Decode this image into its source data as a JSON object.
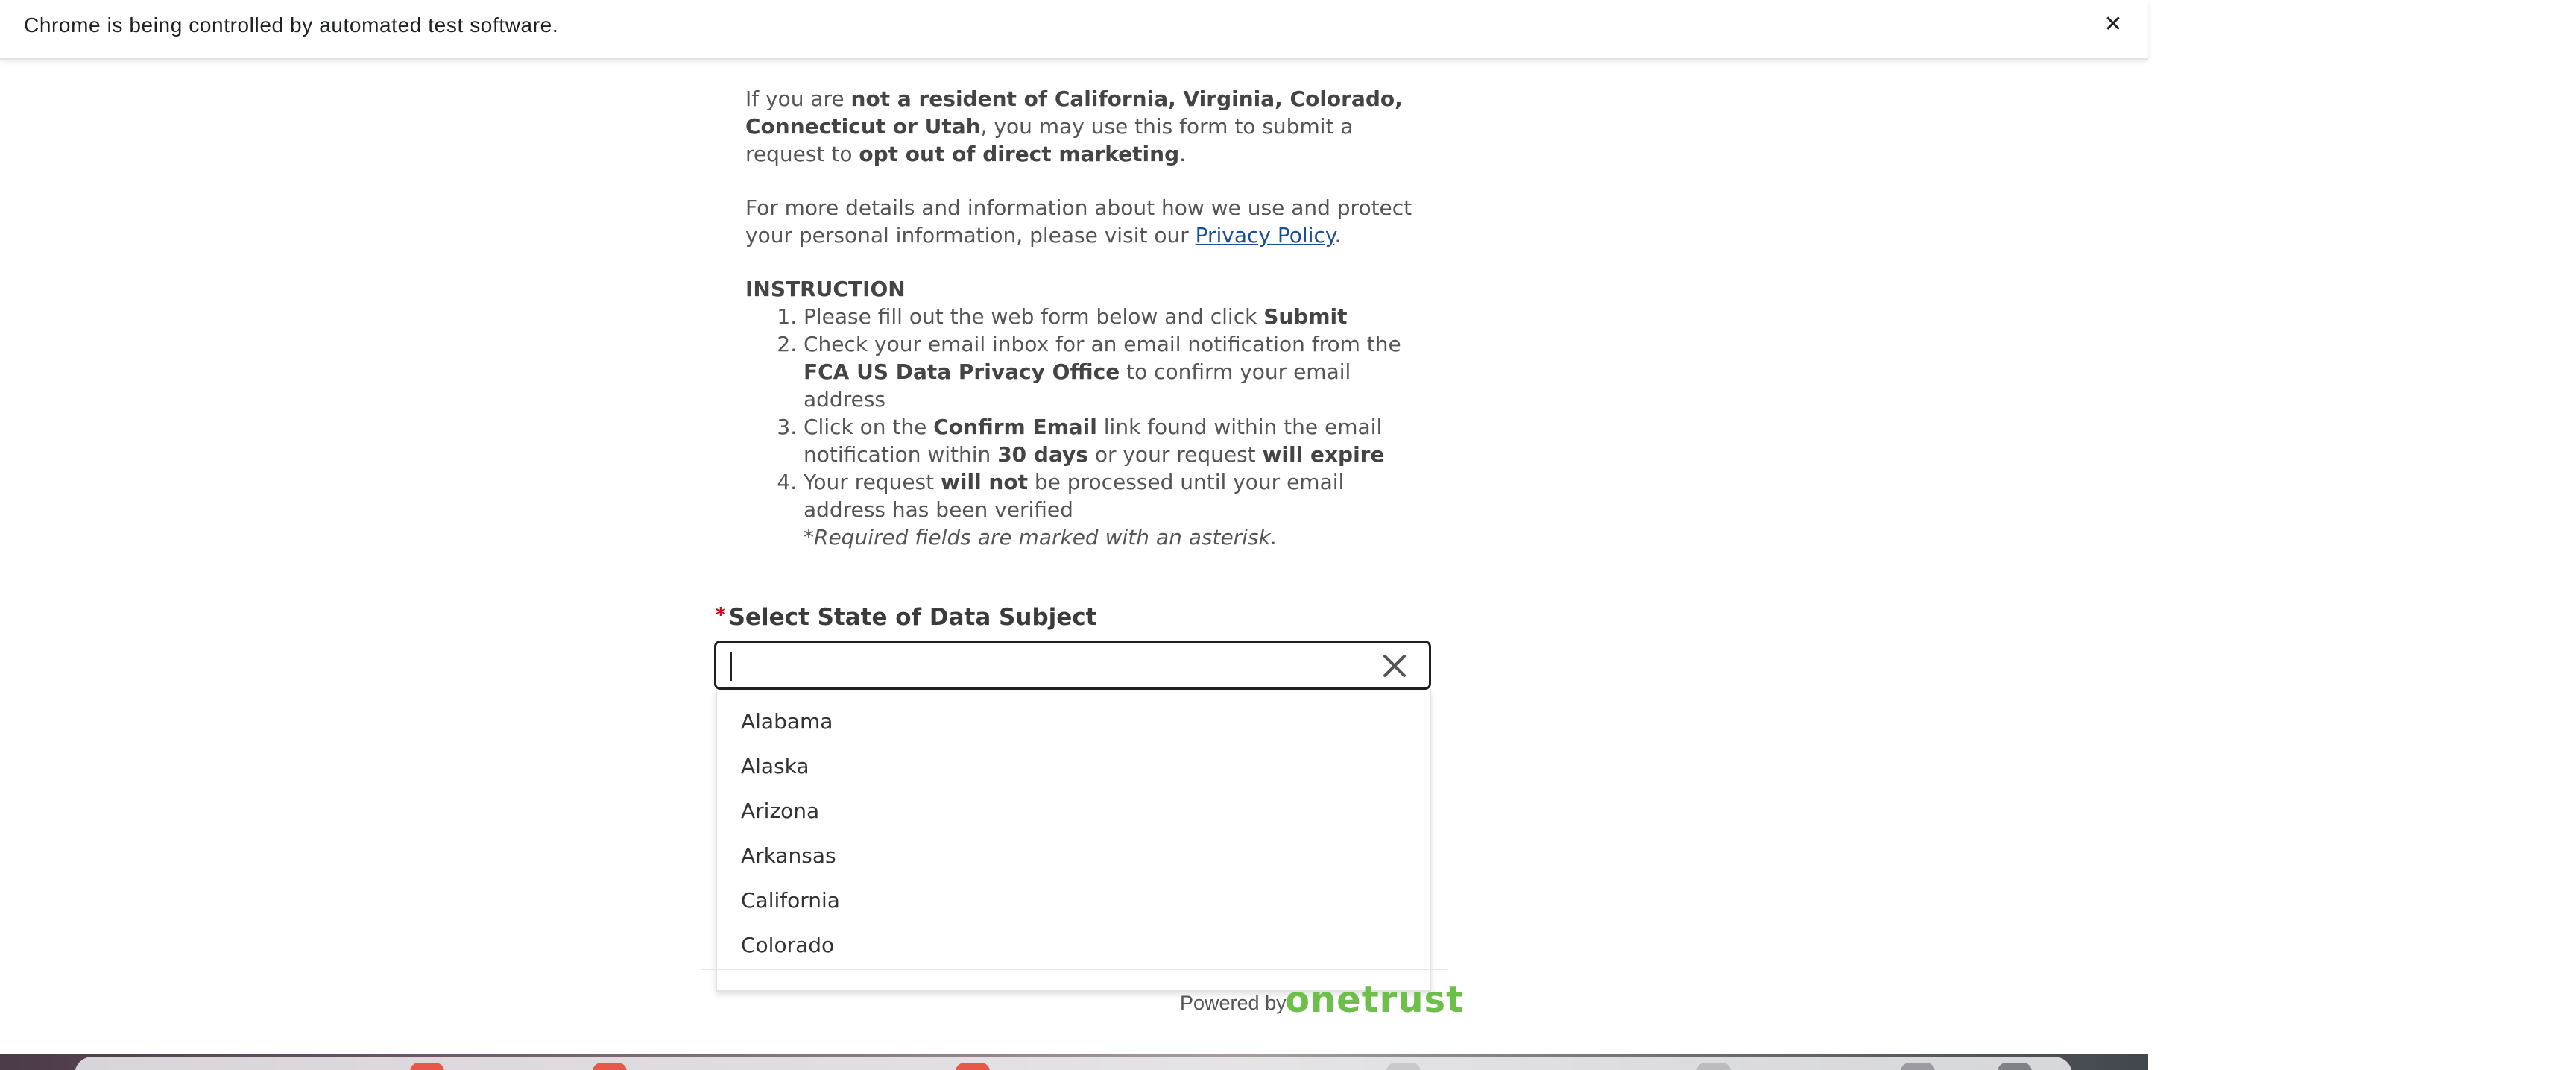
{
  "infobar": {
    "message": "Chrome is being controlled by automated test software.",
    "close_icon": "close-icon"
  },
  "intro": {
    "p1_a": "If you are ",
    "p1_b": "not a resident of California, Virginia, Colorado, Connecticut or Utah",
    "p1_c": ", you may use this form to submit a request to ",
    "p1_d": "opt out of direct marketing",
    "p1_e": ".",
    "p2_a": "For more details and information about how we use and protect your personal information, please visit our ",
    "p2_link": "Privacy Policy",
    "p2_e": "."
  },
  "instructions": {
    "title": "INSTRUCTION",
    "s1_a": "Please fill out the web form below and click ",
    "s1_b": "Submit",
    "s2_a": "Check your email inbox for an email notification from the ",
    "s2_b": "FCA US Data Privacy Office",
    "s2_c": " to confirm your email address",
    "s3_a": "Click on the ",
    "s3_b": "Confirm Email",
    "s3_c": " link found within the email notification within ",
    "s3_d": "30 days",
    "s3_e": " or your request ",
    "s3_f": "will expire",
    "s4_a": "Your request ",
    "s4_b": "will not",
    "s4_c": " be processed until your email address has been verified",
    "note": "*Required fields are marked with an asterisk."
  },
  "state_field": {
    "required_marker": "*",
    "label": "Select State of Data Subject",
    "value": "",
    "clear_icon": "close-icon",
    "options": [
      "Alabama",
      "Alaska",
      "Arizona",
      "Arkansas",
      "California",
      "Colorado"
    ]
  },
  "footer": {
    "powered_by": "Powered by",
    "brand": "onetrust"
  },
  "colors": {
    "link": "#1b4f97",
    "required": "#d0021b",
    "brand": "#6cc04a"
  }
}
